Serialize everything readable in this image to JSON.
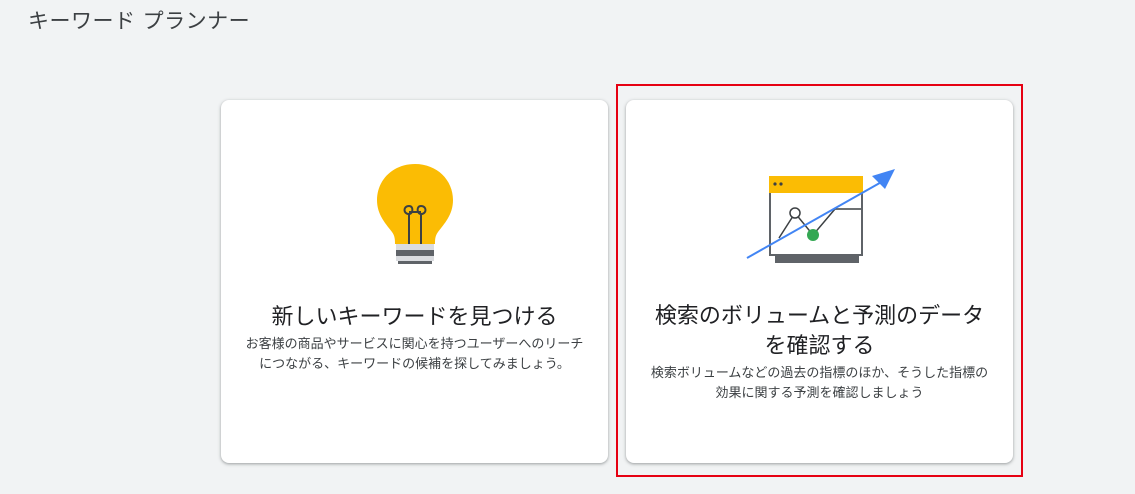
{
  "page": {
    "title": "キーワード プランナー"
  },
  "cards": [
    {
      "id": "discover",
      "icon": "lightbulb-icon",
      "title": "新しいキーワードを見つける",
      "description": "お客様の商品やサービスに関心を持つユーザーへのリーチにつながる、キーワードの候補を探してみましょう。"
    },
    {
      "id": "forecast",
      "icon": "trend-chart-icon",
      "title": "検索のボリュームと予測のデータを確認する",
      "description": "検索ボリュームなどの過去の指標のほか、そうした指標の効果に関する予測を確認しましょう"
    }
  ],
  "colors": {
    "background": "#f1f3f4",
    "card": "#ffffff",
    "bulb_yellow": "#fbbc04",
    "chart_blue": "#4285f4",
    "chart_green": "#34a853",
    "highlight_red": "#e60012"
  }
}
